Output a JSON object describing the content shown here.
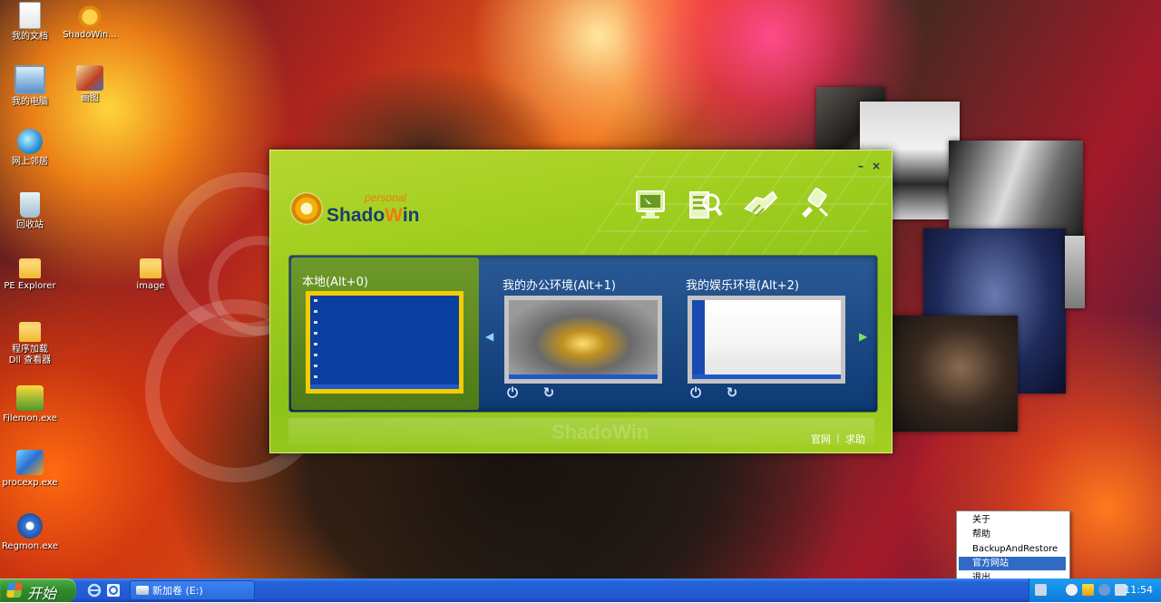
{
  "desktop": {
    "icons": [
      {
        "label": "我的文档",
        "icon": "documents-icon"
      },
      {
        "label": "ShadoWin...",
        "icon": "shadowin-icon"
      },
      {
        "label": "我的电脑",
        "icon": "computer-icon"
      },
      {
        "label": "画图",
        "icon": "paint-icon"
      },
      {
        "label": "网上邻居",
        "icon": "network-icon"
      },
      {
        "label": "回收站",
        "icon": "recycle-bin-icon"
      },
      {
        "label": "PE Explorer",
        "icon": "folder-icon"
      },
      {
        "label": "image",
        "icon": "folder-icon"
      },
      {
        "label": "程序加载",
        "icon": "folder-icon"
      },
      {
        "label": "Dll 查看器",
        "icon": "folder-icon"
      },
      {
        "label": "Filemon.exe",
        "icon": "filemon-icon"
      },
      {
        "label": "procexp.exe",
        "icon": "procexp-icon"
      },
      {
        "label": "Regmon.exe",
        "icon": "regmon-icon"
      }
    ]
  },
  "shadowin": {
    "logo_small": "personal",
    "logo_main": "Shado",
    "logo_w": "W",
    "logo_end": "in",
    "minimize": "–",
    "close": "×",
    "tool_icons": [
      "monitor-icon",
      "search-icon",
      "handshake-icon",
      "plug-icon"
    ],
    "environments": [
      {
        "title": "本地(Alt+0)",
        "selected": true
      },
      {
        "title": "我的办公环境(Alt+1)",
        "selected": false
      },
      {
        "title": "我的娱乐环境(Alt+2)",
        "selected": false
      }
    ],
    "nav_left": "◀",
    "nav_right": "▶",
    "power_glyph": "⏻",
    "restart_glyph": "↻",
    "footer_ghost": "ShadoWin",
    "footer_links": [
      "官网",
      "求助"
    ],
    "footer_sep": "|"
  },
  "context_menu": {
    "items": [
      "关于",
      "帮助",
      "BackupAndRestore",
      "官方网站",
      "退出"
    ],
    "active_index": 3
  },
  "taskbar": {
    "start_label": "开始",
    "task_button": "新加卷 (E:)",
    "clock": "11:54"
  },
  "colors": {
    "window_green": "#9fce1e",
    "panel_blue": "#0e3a74",
    "selected_border": "#f5cc00",
    "taskbar_blue": "#2357d0",
    "menu_highlight": "#316ac5"
  }
}
